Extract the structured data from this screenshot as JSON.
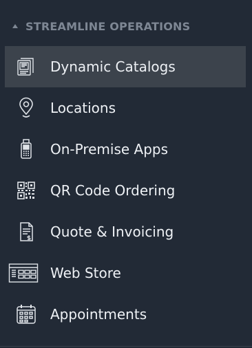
{
  "section": {
    "title": "STREAMLINE OPERATIONS",
    "expanded": true
  },
  "menu": {
    "items": [
      {
        "label": "Dynamic Catalogs",
        "icon": "catalog-icon",
        "active": true
      },
      {
        "label": "Locations",
        "icon": "location-pin-icon",
        "active": false
      },
      {
        "label": "On-Premise Apps",
        "icon": "pos-terminal-icon",
        "active": false
      },
      {
        "label": "QR Code Ordering",
        "icon": "qr-code-icon",
        "active": false
      },
      {
        "label": "Quote & Invoicing",
        "icon": "invoice-icon",
        "active": false
      },
      {
        "label": "Web Store",
        "icon": "web-store-icon",
        "active": false
      },
      {
        "label": "Appointments",
        "icon": "calendar-icon",
        "active": false
      }
    ]
  },
  "colors": {
    "background": "#222a36",
    "active_item": "#3c434c",
    "header_text": "#7e8794",
    "item_text": "#eef1f5",
    "icon": "#dfe3e8"
  }
}
